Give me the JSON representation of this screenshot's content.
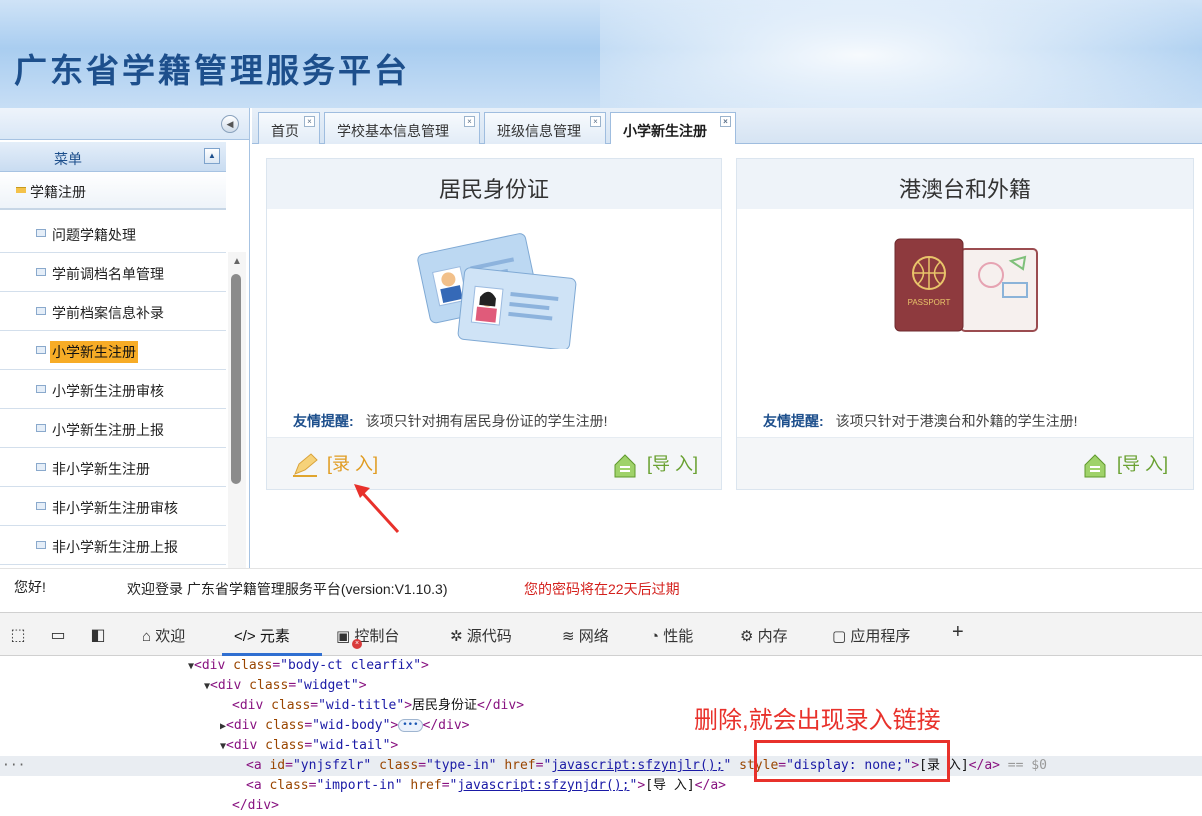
{
  "app_title": "广东省学籍管理服务平台",
  "sidebar": {
    "menu_title": "菜单",
    "group_label": "学籍注册",
    "items": [
      {
        "label": "问题学籍处理"
      },
      {
        "label": "学前调档名单管理"
      },
      {
        "label": "学前档案信息补录"
      },
      {
        "label": "小学新生注册",
        "active": true
      },
      {
        "label": "小学新生注册审核"
      },
      {
        "label": "小学新生注册上报"
      },
      {
        "label": "非小学新生注册"
      },
      {
        "label": "非小学新生注册审核"
      },
      {
        "label": "非小学新生注册上报"
      }
    ]
  },
  "tabs": [
    {
      "label": "首页"
    },
    {
      "label": "学校基本信息管理"
    },
    {
      "label": "班级信息管理"
    },
    {
      "label": "小学新生注册",
      "active": true
    }
  ],
  "cards": {
    "resident": {
      "title": "居民身份证",
      "tip_key": "友情提醒:",
      "tip_text": "该项只针对拥有居民身份证的学生注册!",
      "input_link": "[录 入]",
      "import_link": "[导 入]"
    },
    "overseas": {
      "title": "港澳台和外籍",
      "tip_key": "友情提醒:",
      "tip_text": "该项只针对于港澳台和外籍的学生注册!",
      "import_link": "[导 入]",
      "passport_text": "PASSPORT"
    }
  },
  "status": {
    "hello": "您好!",
    "welcome": "欢迎登录  广东省学籍管理服务平台(version:V1.10.3)",
    "warning": "您的密码将在22天后过期"
  },
  "devtools": {
    "tabs": [
      {
        "label": "欢迎",
        "icon": "home-icon"
      },
      {
        "label": "元素",
        "icon": "code-icon",
        "active": true
      },
      {
        "label": "控制台",
        "icon": "console-icon"
      },
      {
        "label": "源代码",
        "icon": "bug-icon"
      },
      {
        "label": "网络",
        "icon": "wifi-icon"
      },
      {
        "label": "性能",
        "icon": "gauge-icon"
      },
      {
        "label": "内存",
        "icon": "gear-icon"
      },
      {
        "label": "应用程序",
        "icon": "app-icon"
      }
    ],
    "badge": "×",
    "add_label": "+",
    "code": {
      "l1_tag": "div",
      "l1_attr": "class",
      "l1_val": "\"body-ct clearfix\"",
      "l2_tag": "div",
      "l2_attr": "class",
      "l2_val": "\"widget\"",
      "l3_tag": "div",
      "l3_attr": "class",
      "l3_val": "\"wid-title\"",
      "l3_text": "居民身份证",
      "l4_tag": "div",
      "l4_attr": "class",
      "l4_val": "\"wid-body\"",
      "l5_tag": "div",
      "l5_attr": "class",
      "l5_val": "\"wid-tail\"",
      "l6_tag": "a",
      "l6_id_attr": "id",
      "l6_id_val": "\"ynjsfzlr\"",
      "l6_class_attr": "class",
      "l6_class_val": "\"type-in\"",
      "l6_href_attr": "href",
      "l6_href_val": "javascript:sfzynjlr();",
      "l6_style_attr": "style",
      "l6_style_val": "\"display: none;\"",
      "l6_text": "[录 入]",
      "l6_dollar": "== $0",
      "l7_tag": "a",
      "l7_class_attr": "class",
      "l7_class_val": "\"import-in\"",
      "l7_href_attr": "href",
      "l7_href_val": "javascript:sfzynjdr();",
      "l7_text": "[导 入]",
      "l8_close": "</div>"
    }
  },
  "annotation": "删除,就会出现录入链接",
  "colors": {
    "accent_red": "#e8312b",
    "active_item": "#f7ac26",
    "brand_blue": "#1d4f8c"
  }
}
